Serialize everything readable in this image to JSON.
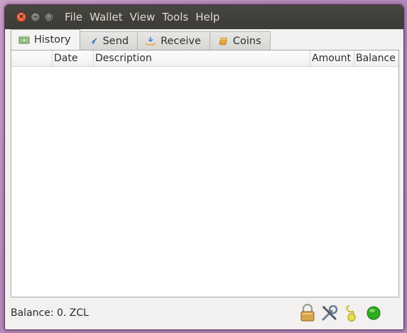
{
  "titlebar": {
    "close_glyph": "×",
    "minimize_glyph": "–",
    "maximize_glyph": "□"
  },
  "menu": [
    "File",
    "Wallet",
    "View",
    "Tools",
    "Help"
  ],
  "tabs": [
    {
      "label": "History",
      "icon": "history-icon",
      "active": true
    },
    {
      "label": "Send",
      "icon": "send-icon",
      "active": false
    },
    {
      "label": "Receive",
      "icon": "receive-icon",
      "active": false
    },
    {
      "label": "Coins",
      "icon": "coins-icon",
      "active": false
    }
  ],
  "table": {
    "columns": [
      "",
      "Date",
      "Description",
      "Amount",
      "Balance"
    ],
    "rows": []
  },
  "status": {
    "balance_text": "Balance: 0. ZCL",
    "icons": [
      "lock-icon",
      "preferences-tools-icon",
      "seed-icon",
      "connection-status-icon"
    ]
  },
  "colors": {
    "connected": "#2eab1f",
    "titlebar": "#3c3b37",
    "close": "#e2512a"
  }
}
